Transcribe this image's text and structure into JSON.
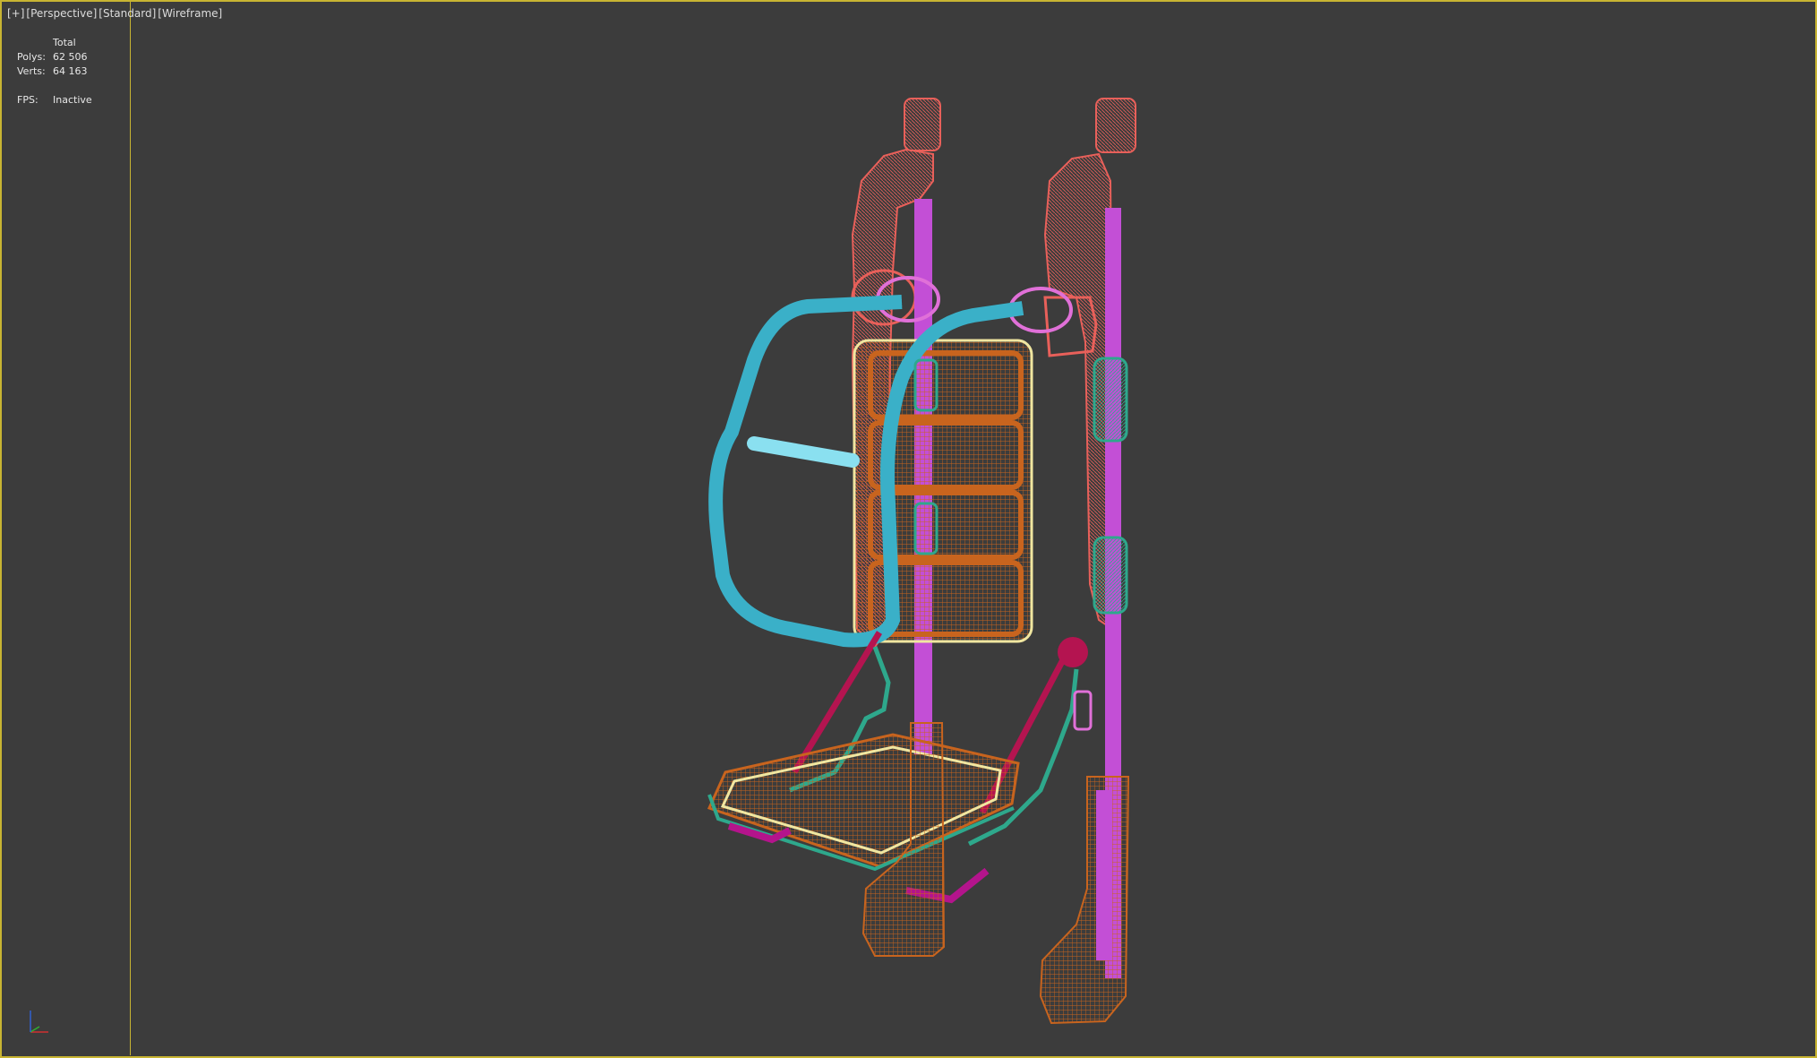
{
  "viewport": {
    "labels": [
      "[+]",
      "[Perspective]",
      "[Standard]",
      "[Wireframe]"
    ],
    "frame_color": "#c8b432",
    "background_color": "#3c3c3c"
  },
  "stats": {
    "header": "Total",
    "polys_label": "Polys:",
    "polys_value": "62 506",
    "verts_label": "Verts:",
    "verts_value": "64 163",
    "fps_label": "FPS:",
    "fps_value": "Inactive"
  },
  "model_colors": {
    "frame_red": "#e8605a",
    "pole_magenta": "#c34fd6",
    "tube_cyan": "#3ab0c8",
    "cushion_orange": "#c8641e",
    "cushion_yellow": "#f0e6a0",
    "bracket_teal": "#2ea88c",
    "strap_crimson": "#b41450",
    "clamp_pink": "#e070d8"
  },
  "gizmo": {
    "axes": [
      "x-axis",
      "y-axis",
      "z-axis"
    ],
    "x_color": "#d03030",
    "y_color": "#30b030",
    "z_color": "#3060d0"
  }
}
